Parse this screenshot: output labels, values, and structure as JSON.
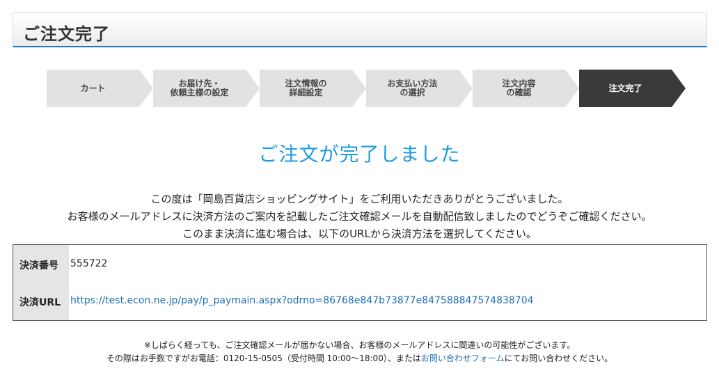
{
  "header": {
    "title": "ご注文完了"
  },
  "steps": [
    {
      "label": "カート",
      "active": false
    },
    {
      "label": "お届け先・\n依頼主様の設定",
      "active": false
    },
    {
      "label": "注文情報の\n詳細設定",
      "active": false
    },
    {
      "label": "お支払い方法\nの選択",
      "active": false
    },
    {
      "label": "注文内容\nの確認",
      "active": false
    },
    {
      "label": "注文完了",
      "active": true
    }
  ],
  "main": {
    "complete_title": "ご注文が完了しました",
    "message_lines": [
      "この度は「岡島百貨店ショッピングサイト」をご利用いただきありがとうございました。",
      "お客様のメールアドレスに決済方法のご案内を記載したご注文確認メールを自動配信致しましたのでどうぞご確認ください。",
      "このまま決済に進む場合は、以下のURLから決済方法を選択してください。"
    ]
  },
  "payment": {
    "number_label": "決済番号",
    "number_value": "555722",
    "url_label": "決済URL",
    "url_value": "https://test.econ.ne.jp/pay/p_paymain.aspx?odrno=86768e847b73877e847588847574838704"
  },
  "notes": {
    "line1": "※しばらく経っても、ご注文確認メールが届かない場合、お客様のメールアドレスに間違いの可能性がございます。",
    "line2_prefix": "その際はお手数ですがお電話：0120-15-0505（受付時間 10:00～18:00）、または",
    "contact_link": "お問い合わせフォーム",
    "line2_suffix": "にてお問い合わせください。"
  },
  "colors": {
    "accent_blue": "#1b7cc4",
    "title_blue": "#1e9be0",
    "link_blue": "#1f6fb5",
    "step_active": "#3a3a3a",
    "step_inactive": "#e2e2e2"
  }
}
